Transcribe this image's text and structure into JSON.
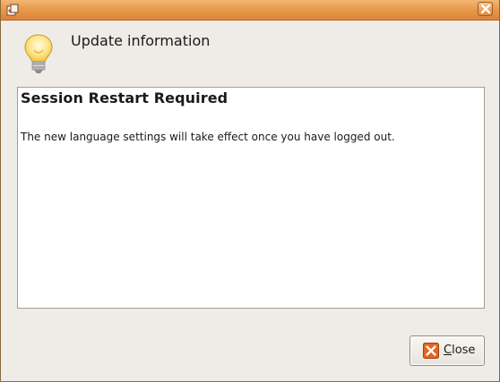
{
  "window": {
    "title_icon": "application-icon",
    "close_icon": "close-icon"
  },
  "header": {
    "icon": "lightbulb-icon",
    "title": "Update information"
  },
  "content": {
    "heading": "Session Restart Required",
    "body": "The new language settings will take effect once you have logged out."
  },
  "footer": {
    "close_button": {
      "label": "Close",
      "icon": "close-x-icon"
    }
  },
  "colors": {
    "titlebar": "#e99a4c",
    "window_bg": "#efebe7",
    "content_bg": "#ffffff",
    "button_icon": "#e06a1b"
  }
}
